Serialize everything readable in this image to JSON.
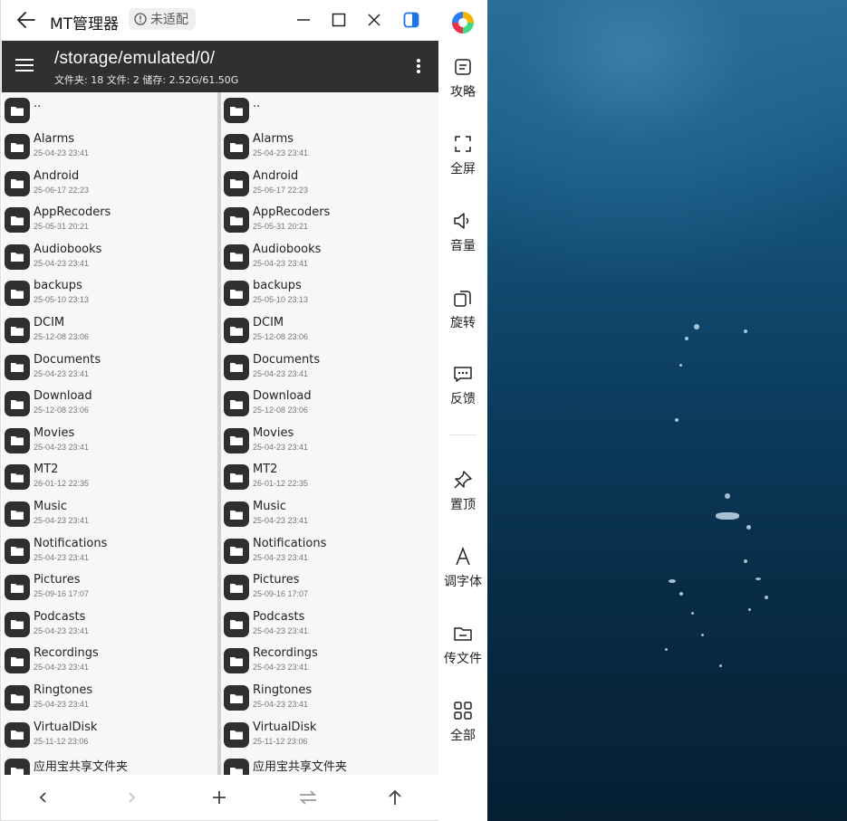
{
  "window": {
    "title": "MT管理器",
    "badge": "未适配"
  },
  "appbar": {
    "path": "/storage/emulated/0/",
    "stats": "文件夹: 18  文件: 2  储存: 2.52G/61.50G"
  },
  "parent_label": "..",
  "left_pane": {
    "items": [
      {
        "name": "Alarms",
        "date": "25-04-23 23:41"
      },
      {
        "name": "Android",
        "date": "25-06-17 22:23"
      },
      {
        "name": "AppRecoders",
        "date": "25-05-31 20:21"
      },
      {
        "name": "Audiobooks",
        "date": "25-04-23 23:41"
      },
      {
        "name": "backups",
        "date": "25-05-10 23:13"
      },
      {
        "name": "DCIM",
        "date": "25-12-08 23:06"
      },
      {
        "name": "Documents",
        "date": "25-04-23 23:41"
      },
      {
        "name": "Download",
        "date": "25-12-08 23:06"
      },
      {
        "name": "Movies",
        "date": "25-04-23 23:41"
      },
      {
        "name": "MT2",
        "date": "26-01-12 22:35"
      },
      {
        "name": "Music",
        "date": "25-04-23 23:41"
      },
      {
        "name": "Notifications",
        "date": "25-04-23 23:41"
      },
      {
        "name": "Pictures",
        "date": "25-09-16 17:07"
      },
      {
        "name": "Podcasts",
        "date": "25-04-23 23:41"
      },
      {
        "name": "Recordings",
        "date": "25-04-23 23:41"
      },
      {
        "name": "Ringtones",
        "date": "25-04-23 23:41"
      },
      {
        "name": "VirtualDisk",
        "date": "25-11-12 23:06"
      },
      {
        "name": "应用宝共享文件夹",
        "date": ""
      }
    ]
  },
  "right_pane": {
    "items": [
      {
        "name": "Alarms",
        "date": "25-04-23 23:41"
      },
      {
        "name": "Android",
        "date": "25-06-17 22:23"
      },
      {
        "name": "AppRecoders",
        "date": "25-05-31 20:21"
      },
      {
        "name": "Audiobooks",
        "date": "25-04-23 23:41"
      },
      {
        "name": "backups",
        "date": "25-05-10 23:13"
      },
      {
        "name": "DCIM",
        "date": "25-12-08 23:06"
      },
      {
        "name": "Documents",
        "date": "25-04-23 23:41"
      },
      {
        "name": "Download",
        "date": "25-12-08 23:06"
      },
      {
        "name": "Movies",
        "date": "25-04-23 23:41"
      },
      {
        "name": "MT2",
        "date": "26-01-12 22:35"
      },
      {
        "name": "Music",
        "date": "25-04-23 23:41"
      },
      {
        "name": "Notifications",
        "date": "25-04-23 23:41"
      },
      {
        "name": "Pictures",
        "date": "25-09-16 17:07"
      },
      {
        "name": "Podcasts",
        "date": "25-04-23 23:41"
      },
      {
        "name": "Recordings",
        "date": "25-04-23 23:41"
      },
      {
        "name": "Ringtones",
        "date": "25-04-23 23:41"
      },
      {
        "name": "VirtualDisk",
        "date": "25-11-12 23:06"
      },
      {
        "name": "应用宝共享文件夹",
        "date": ""
      }
    ]
  },
  "sidepanel": {
    "items": [
      {
        "label": "攻略",
        "icon": "guide-icon"
      },
      {
        "label": "全屏",
        "icon": "fullscreen-icon"
      },
      {
        "label": "音量",
        "icon": "volume-icon"
      },
      {
        "label": "旋转",
        "icon": "rotate-icon"
      },
      {
        "label": "反馈",
        "icon": "feedback-icon"
      },
      {
        "label": "置顶",
        "icon": "pin-icon"
      },
      {
        "label": "调字体",
        "icon": "font-icon"
      },
      {
        "label": "传文件",
        "icon": "folder-transfer-icon"
      },
      {
        "label": "全部",
        "icon": "grid-icon"
      }
    ]
  },
  "colors": {
    "appbar": "#303030",
    "accent_blue": "#1a73e8",
    "folder_icon": "#2f2f2f"
  }
}
